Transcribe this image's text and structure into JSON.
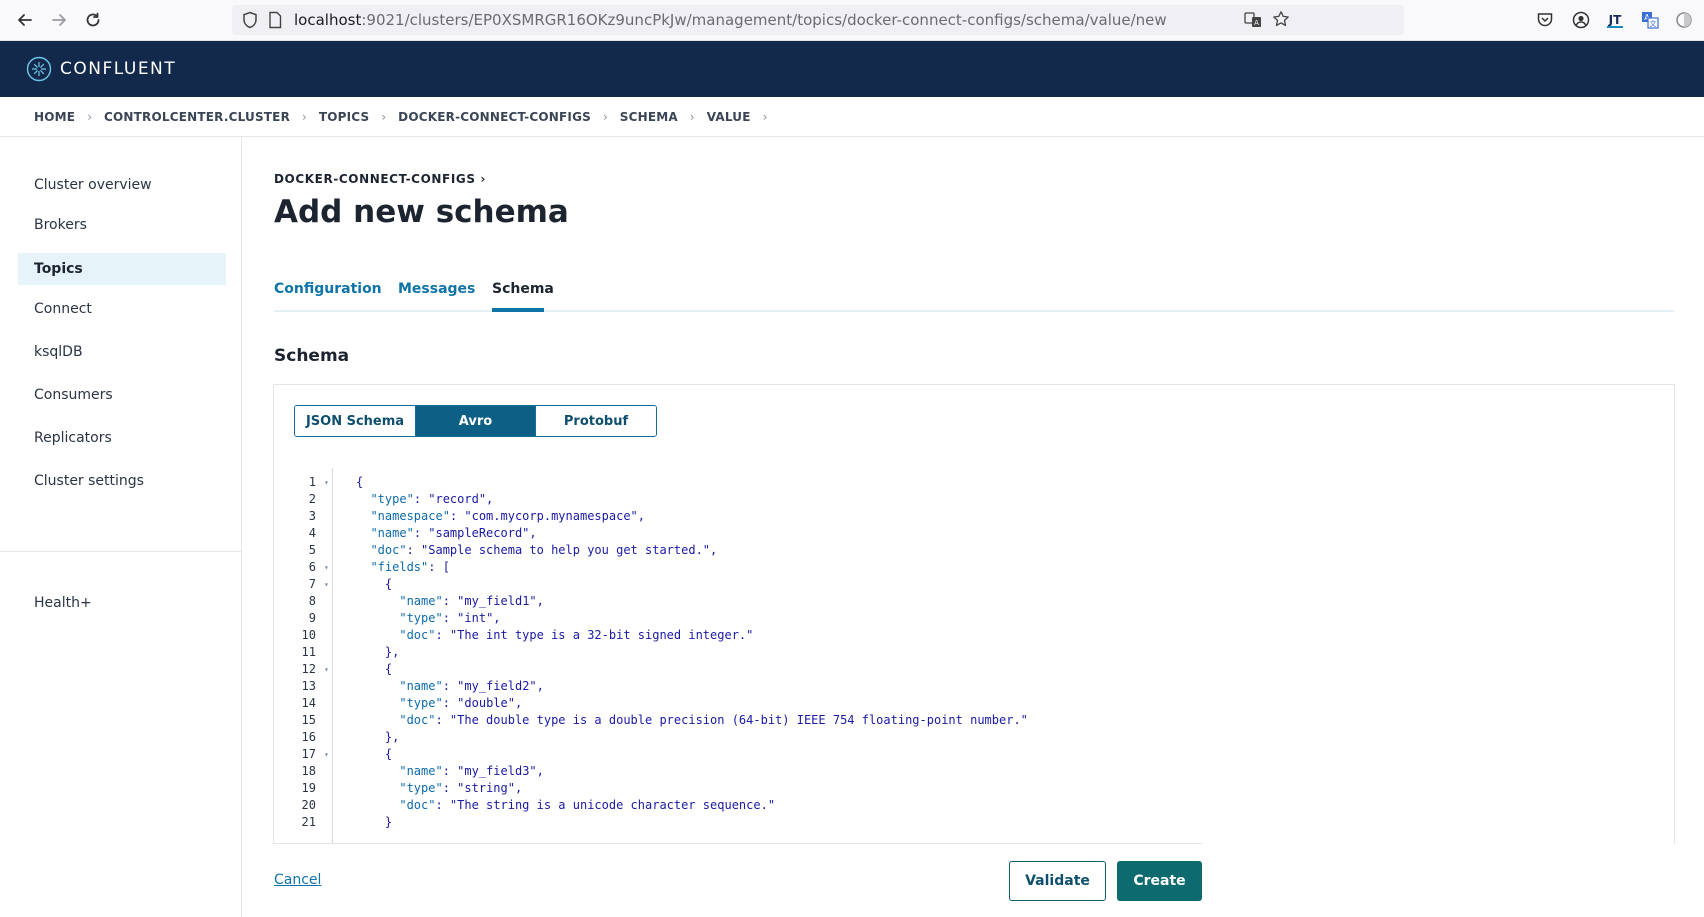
{
  "browser": {
    "url_host": "localhost",
    "url_rest": ":9021/clusters/EP0XSMRGR16OKz9uncPkJw/management/topics/docker-connect-configs/schema/value/new"
  },
  "header": {
    "logo_text": "CONFLUENT"
  },
  "breadcrumb": [
    "HOME",
    "CONTROLCENTER.CLUSTER",
    "TOPICS",
    "DOCKER-CONNECT-CONFIGS",
    "SCHEMA",
    "VALUE"
  ],
  "sidebar": {
    "items": [
      {
        "label": "Cluster overview",
        "active": false
      },
      {
        "label": "Brokers",
        "active": false
      },
      {
        "label": "Topics",
        "active": true
      },
      {
        "label": "Connect",
        "active": false
      },
      {
        "label": "ksqlDB",
        "active": false
      },
      {
        "label": "Consumers",
        "active": false
      },
      {
        "label": "Replicators",
        "active": false
      },
      {
        "label": "Cluster settings",
        "active": false
      }
    ],
    "bottom_item": "Health+"
  },
  "main": {
    "subtitle": "DOCKER-CONNECT-CONFIGS ›",
    "title": "Add new schema",
    "tabs": [
      {
        "label": "Configuration",
        "active": false
      },
      {
        "label": "Messages",
        "active": false
      },
      {
        "label": "Schema",
        "active": true
      }
    ],
    "section_title": "Schema",
    "format_options": [
      {
        "label": "JSON Schema",
        "active": false
      },
      {
        "label": "Avro",
        "active": true
      },
      {
        "label": "Protobuf",
        "active": false
      }
    ],
    "code_lines": [
      {
        "n": "1",
        "fold": true,
        "text": "{"
      },
      {
        "n": "2",
        "fold": false,
        "text": "  \"type\": \"record\","
      },
      {
        "n": "3",
        "fold": false,
        "text": "  \"namespace\": \"com.mycorp.mynamespace\","
      },
      {
        "n": "4",
        "fold": false,
        "text": "  \"name\": \"sampleRecord\","
      },
      {
        "n": "5",
        "fold": false,
        "text": "  \"doc\": \"Sample schema to help you get started.\","
      },
      {
        "n": "6",
        "fold": true,
        "text": "  \"fields\": ["
      },
      {
        "n": "7",
        "fold": true,
        "text": "    {"
      },
      {
        "n": "8",
        "fold": false,
        "text": "      \"name\": \"my_field1\","
      },
      {
        "n": "9",
        "fold": false,
        "text": "      \"type\": \"int\","
      },
      {
        "n": "10",
        "fold": false,
        "text": "      \"doc\": \"The int type is a 32-bit signed integer.\""
      },
      {
        "n": "11",
        "fold": false,
        "text": "    },"
      },
      {
        "n": "12",
        "fold": true,
        "text": "    {"
      },
      {
        "n": "13",
        "fold": false,
        "text": "      \"name\": \"my_field2\","
      },
      {
        "n": "14",
        "fold": false,
        "text": "      \"type\": \"double\","
      },
      {
        "n": "15",
        "fold": false,
        "text": "      \"doc\": \"The double type is a double precision (64-bit) IEEE 754 floating-point number.\""
      },
      {
        "n": "16",
        "fold": false,
        "text": "    },"
      },
      {
        "n": "17",
        "fold": true,
        "text": "    {"
      },
      {
        "n": "18",
        "fold": false,
        "text": "      \"name\": \"my_field3\","
      },
      {
        "n": "19",
        "fold": false,
        "text": "      \"type\": \"string\","
      },
      {
        "n": "20",
        "fold": false,
        "text": "      \"doc\": \"The string is a unicode character sequence.\""
      },
      {
        "n": "21",
        "fold": false,
        "text": "    }"
      }
    ],
    "cancel_label": "Cancel",
    "validate_label": "Validate",
    "create_label": "Create"
  },
  "colors": {
    "header_bg": "#13294b",
    "accent": "#0f74a8",
    "primary_button": "#0d6a6e"
  },
  "icons": [
    "back-arrow-icon",
    "forward-arrow-icon",
    "reload-icon",
    "shield-icon",
    "page-icon",
    "translate-icon",
    "star-icon",
    "pocket-icon",
    "account-icon",
    "extension-icon",
    "translate-ext-icon",
    "extension-puzzle-icon",
    "confluent-logo-icon",
    "chevron-right-icon"
  ]
}
